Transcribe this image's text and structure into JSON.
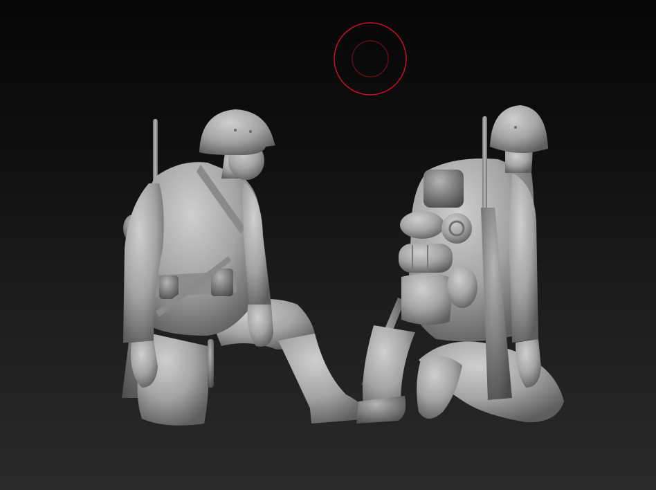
{
  "viewport": {
    "background_top": "#060606",
    "background_bottom": "#2a2a2a",
    "model_color": "#a9a9a9"
  },
  "brush_cursor": {
    "icon": "brush-cursor-icon",
    "color": "#c8102e"
  },
  "models": [
    {
      "icon": "kneeling-soldier-front-icon"
    },
    {
      "icon": "kneeling-soldier-back-icon"
    }
  ]
}
